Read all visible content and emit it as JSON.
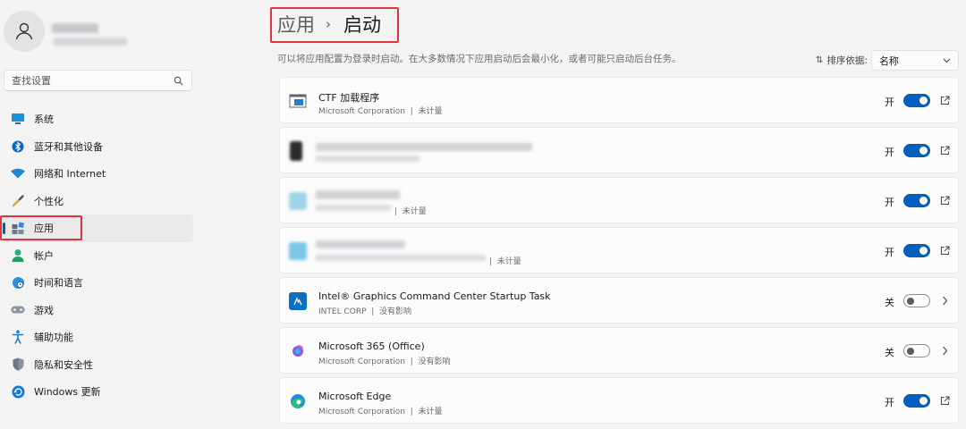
{
  "sidebar": {
    "search": {
      "placeholder": "查找设置"
    },
    "items": [
      {
        "label": "系统",
        "icon": "system-icon"
      },
      {
        "label": "蓝牙和其他设备",
        "icon": "bluetooth-icon"
      },
      {
        "label": "网络和 Internet",
        "icon": "wifi-icon"
      },
      {
        "label": "个性化",
        "icon": "brush-icon"
      },
      {
        "label": "应用",
        "icon": "apps-icon",
        "active": true
      },
      {
        "label": "帐户",
        "icon": "account-icon"
      },
      {
        "label": "时间和语言",
        "icon": "globe-icon"
      },
      {
        "label": "游戏",
        "icon": "gamepad-icon"
      },
      {
        "label": "辅助功能",
        "icon": "accessibility-icon"
      },
      {
        "label": "隐私和安全性",
        "icon": "shield-icon"
      },
      {
        "label": "Windows 更新",
        "icon": "update-icon"
      }
    ]
  },
  "header": {
    "breadcrumb_parent": "应用",
    "breadcrumb_separator": "›",
    "title": "启动"
  },
  "description": "可以将应用配置为登录时启动。在大多数情况下应用启动后会最小化，或者可能只启动后台任务。",
  "sort": {
    "label": "排序依据:",
    "value": "名称"
  },
  "startup_apps": [
    {
      "name": "CTF 加载程序",
      "publisher": "Microsoft Corporation",
      "separator": "|",
      "impact": "未计量",
      "state": "开",
      "on": true,
      "action": "open-external-icon"
    },
    {
      "name": "",
      "publisher": "",
      "separator": "",
      "impact": "",
      "state": "开",
      "on": true,
      "action": "open-external-icon",
      "redacted": true
    },
    {
      "name": "",
      "publisher": "",
      "separator": "|",
      "impact": "未计量",
      "state": "开",
      "on": true,
      "action": "open-external-icon",
      "redacted": true
    },
    {
      "name": "",
      "publisher": "",
      "separator": "|",
      "impact": "未计量",
      "state": "开",
      "on": true,
      "action": "open-external-icon",
      "redacted": true
    },
    {
      "name": "Intel® Graphics Command Center Startup Task",
      "publisher": "INTEL CORP",
      "separator": "|",
      "impact": "没有影响",
      "state": "关",
      "on": false,
      "action": "chevron-right-icon"
    },
    {
      "name": "Microsoft 365 (Office)",
      "publisher": "Microsoft Corporation",
      "separator": "|",
      "impact": "没有影响",
      "state": "关",
      "on": false,
      "action": "chevron-right-icon"
    },
    {
      "name": "Microsoft Edge",
      "publisher": "Microsoft Corporation",
      "separator": "|",
      "impact": "未计量",
      "state": "开",
      "on": true,
      "action": "open-external-icon"
    }
  ],
  "colors": {
    "accent": "#005fb8",
    "highlight_box": "#e0333c"
  }
}
